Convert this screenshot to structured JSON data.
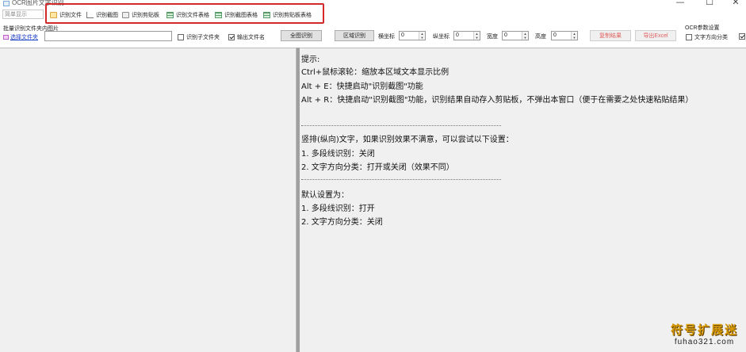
{
  "window": {
    "title": "OCR图片文字识别",
    "minimize_glyph": "—",
    "maximize_glyph": "☐",
    "close_glyph": "✕"
  },
  "toolbar": {
    "simple_mode_label": "简单显示",
    "buttons": [
      {
        "label": "识别文件",
        "icon": "folder-icon"
      },
      {
        "label": "识别截图",
        "icon": "crop-icon"
      },
      {
        "label": "识别剪贴板",
        "icon": "clipboard-icon"
      },
      {
        "label": "识别文件表格",
        "icon": "table-icon"
      },
      {
        "label": "识别截图表格",
        "icon": "table-icon"
      },
      {
        "label": "识别剪贴板表格",
        "icon": "table-icon"
      }
    ],
    "highlight_color": "#d22a2a"
  },
  "batch": {
    "label": "批量识别文件夹内图片",
    "select_folder_link": "选择文件夹",
    "folder_path_value": "",
    "include_subfolders_label": "识别子文件夹",
    "include_subfolders_checked": false,
    "output_filename_label": "输出文件名",
    "output_filename_checked": true,
    "full_recognize_button": "全图识别"
  },
  "region": {
    "region_button": "区域识别",
    "x_label": "横坐标",
    "x_value": "0",
    "y_label": "纵坐标",
    "y_value": "0",
    "width_label": "宽度",
    "width_value": "0",
    "height_label": "高度",
    "height_value": "0"
  },
  "actions": {
    "copy_result_button": "复制结果",
    "export_excel_button": "导出Excel"
  },
  "ocr_params": {
    "title": "OCR参数设置",
    "text_direction_label": "文字方向分类",
    "text_direction_checked": false
  },
  "tips": {
    "title": "提示:",
    "line1": "Ctrl+鼠标滚轮：缩放本区域文本显示比例",
    "line2": "Alt + E：快捷启动\"识别截图\"功能",
    "line3": "Alt + R：快捷启动\"识别截图\"功能，识别结果自动存入剪贴板，不弹出本窗口（便于在需要之处快速粘贴结果）",
    "vertical_title": "竖排(纵向)文字，如果识别效果不满意，可以尝试以下设置：",
    "vertical_item1": "1. 多段线识别：关闭",
    "vertical_item2": "2. 文字方向分类：打开或关闭（效果不同）",
    "default_title": "默认设置为：",
    "default_item1": "1. 多段线识别：打开",
    "default_item2": "2. 文字方向分类：关闭"
  },
  "watermark": {
    "text": "符号扩展迷",
    "url": "fuhao321.com",
    "color": "#d99a00"
  }
}
